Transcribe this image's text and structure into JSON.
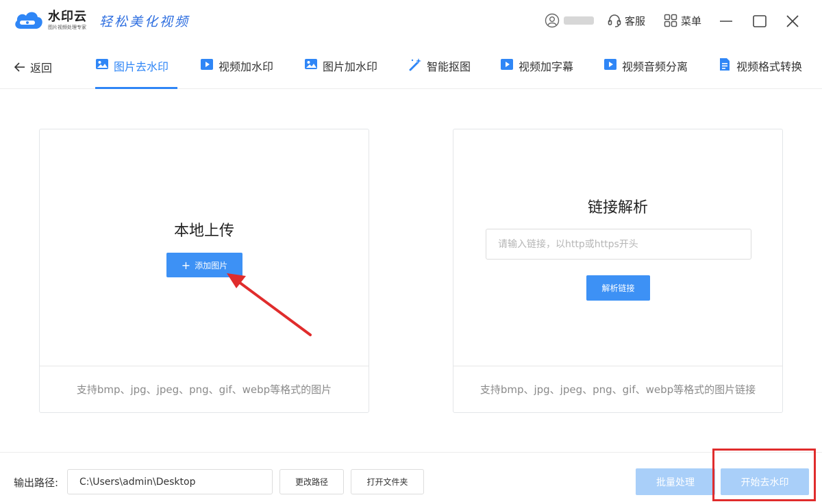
{
  "app": {
    "name": "水印云",
    "subtitle": "图片视频处理专家",
    "slogan": "轻松美化视频",
    "brand_color": "#2f86f6"
  },
  "header": {
    "service_label": "客服",
    "menu_label": "菜单",
    "icons": [
      "user-icon",
      "headset-icon",
      "grid-icon",
      "minimize-icon",
      "maximize-icon",
      "close-icon"
    ]
  },
  "nav": {
    "back_label": "返回",
    "tabs": [
      {
        "label": "图片去水印",
        "icon": "image-icon",
        "active": true
      },
      {
        "label": "视频加水印",
        "icon": "video-icon",
        "active": false
      },
      {
        "label": "图片加水印",
        "icon": "image-icon",
        "active": false
      },
      {
        "label": "智能抠图",
        "icon": "magic-wand-icon",
        "active": false
      },
      {
        "label": "视频加字幕",
        "icon": "video-icon",
        "active": false
      },
      {
        "label": "视频音频分离",
        "icon": "video-icon",
        "active": false
      },
      {
        "label": "视频格式转换",
        "icon": "file-convert-icon",
        "active": false
      }
    ]
  },
  "upload_panel": {
    "title": "本地上传",
    "button_label": "添加图片",
    "footer": "支持bmp、jpg、jpeg、png、gif、webp等格式的图片"
  },
  "link_panel": {
    "title": "链接解析",
    "input_value": "",
    "input_placeholder": "请输入链接，以http或https开头",
    "button_label": "解析链接",
    "footer": "支持bmp、jpg、jpeg、png、gif、webp等格式的图片链接"
  },
  "bottom": {
    "output_label": "输出路径:",
    "path_value": "C:\\Users\\admin\\Desktop",
    "change_path_label": "更改路径",
    "open_folder_label": "打开文件夹",
    "batch_label": "批量处理",
    "start_label": "开始去水印"
  },
  "annotation_color": "#e02c2c"
}
